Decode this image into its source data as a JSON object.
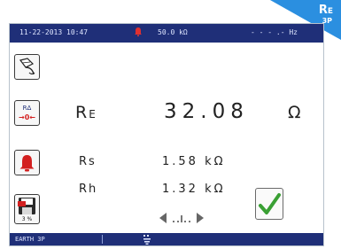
{
  "status_bar": {
    "date": "11-22-2013",
    "time": "10:47",
    "range": "50.0  kΩ",
    "frequency": "- - - .-  Hz",
    "bell_icon": "bell-icon"
  },
  "badge": {
    "title_main": "R",
    "title_sub": "E",
    "subtitle": "3P"
  },
  "sidebar": {
    "probe_icon": "probe-icon",
    "zero_label_top": "RΔ",
    "zero_label_bottom": "→0←",
    "alarm_icon": "alarm-bell-icon",
    "save_label": "3 %"
  },
  "measurements": {
    "re": {
      "label_main": "R",
      "label_sub": "E",
      "value": "32.08",
      "unit": "Ω"
    },
    "rs": {
      "label": "Rs",
      "value": "1.58 kΩ"
    },
    "rh": {
      "label": "Rh",
      "value": "1.32 kΩ"
    }
  },
  "check_icon": "checkmark-icon",
  "navigation": {
    "left_icon": "arrow-left-icon",
    "right_icon": "arrow-right-icon"
  },
  "bottom_bar": {
    "function": "EARTH  3P",
    "symbol_icon": "earth-symbol-icon"
  },
  "colors": {
    "bar_blue": "#1f2f78",
    "badge_blue": "#2b8fe0",
    "check_green": "#3aa034",
    "alarm_red": "#d32020"
  }
}
